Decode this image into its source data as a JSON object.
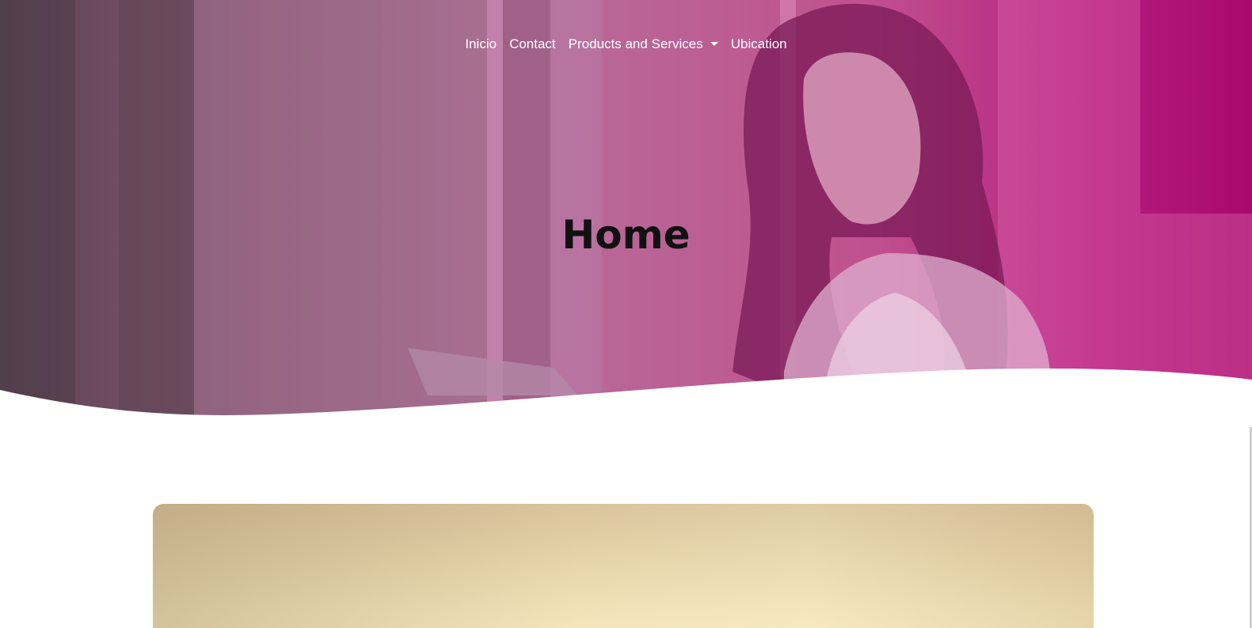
{
  "nav": {
    "items": [
      {
        "label": "Inicio"
      },
      {
        "label": "Contact"
      },
      {
        "label": "Products and Services",
        "has_dropdown": true
      },
      {
        "label": "Ubication"
      }
    ]
  },
  "hero": {
    "title": "Home",
    "overlay_colors": [
      "#5a4452",
      "#b86a98",
      "#a80a6c"
    ]
  },
  "colors": {
    "accent": "#b51c7c",
    "background": "#ffffff"
  }
}
